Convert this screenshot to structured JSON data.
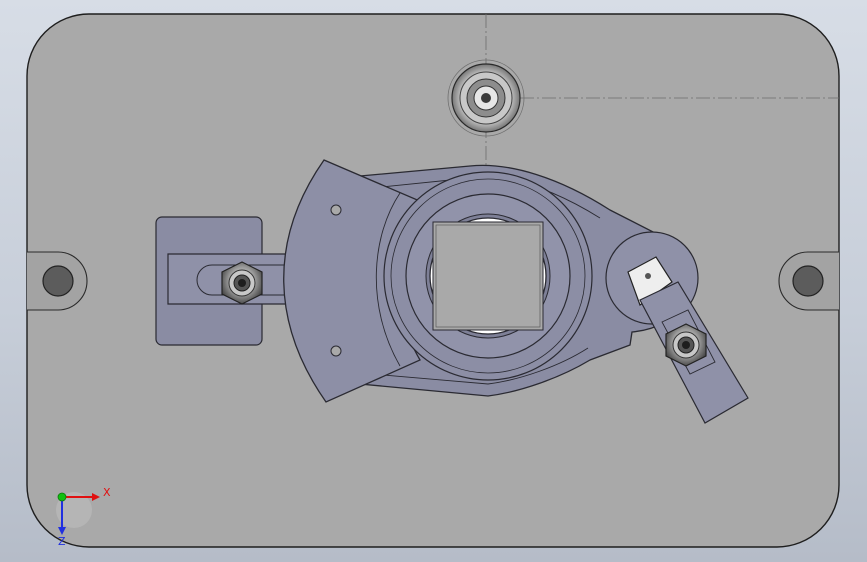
{
  "viewport": {
    "background": "#c9cfd9",
    "plate_color": "#a9a9a9",
    "part_color": "#8a8ca3",
    "part_edge_color": "#2a2a32",
    "cutout_color": "#ffffff"
  },
  "triad": {
    "x_label": "X",
    "z_label": "Z",
    "x_color": "#e01010",
    "y_color": "#10c010",
    "z_color": "#2030e0"
  }
}
